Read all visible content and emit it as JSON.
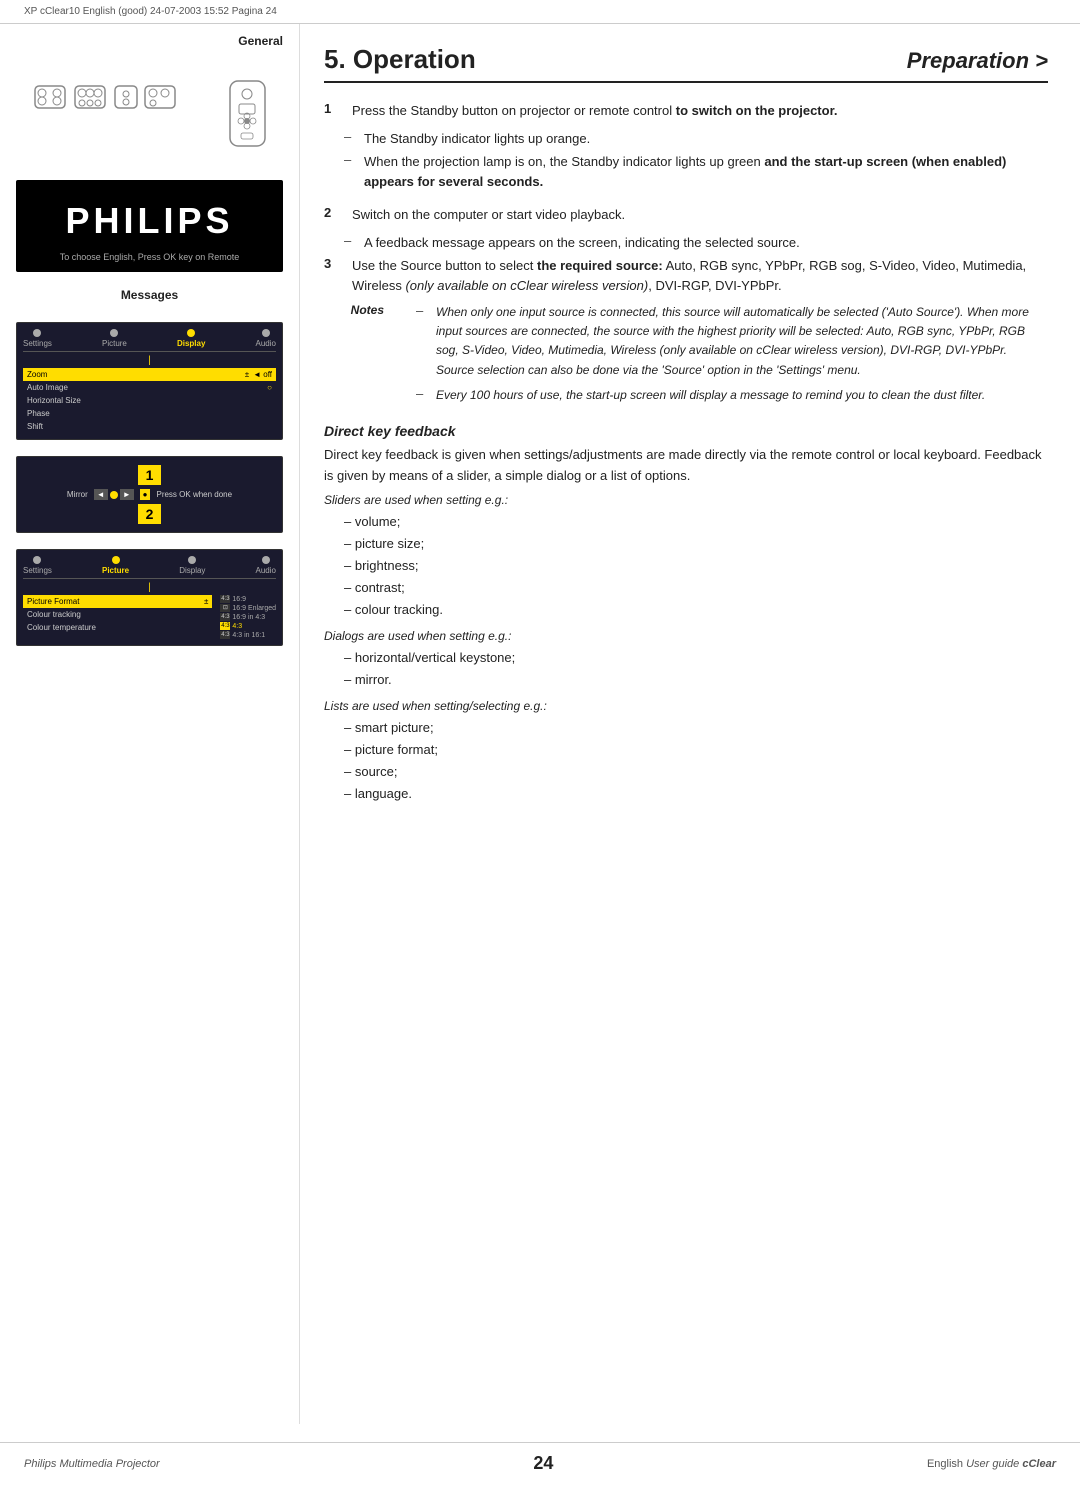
{
  "header": {
    "filename": "XP cClear10 English (good)  24-07-2003  15:52  Pagina 24"
  },
  "sidebar": {
    "general_label": "General",
    "messages_label": "Messages",
    "philips_logo": "PHILIPS",
    "philips_subtitle": "To choose English, Press OK key on Remote",
    "osd1": {
      "tabs": [
        "Settings",
        "Picture",
        "Display",
        "Audio"
      ],
      "active_tab": "Display",
      "rows": [
        {
          "label": "Zoom",
          "value": "±",
          "highlighted": true
        },
        {
          "label": "Auto Image",
          "value": "○"
        },
        {
          "label": "Horizontal Size",
          "value": ""
        },
        {
          "label": "Phase",
          "value": ""
        },
        {
          "label": "Shift",
          "value": ""
        }
      ]
    },
    "keystone": {
      "number_top": "1",
      "label": "Mirror",
      "arrows": [
        "◄",
        "•",
        "►"
      ],
      "press_label": "Press OK when done",
      "number_bottom": "2"
    },
    "osd2": {
      "tabs": [
        "Settings",
        "Picture",
        "Display",
        "Audio"
      ],
      "active_tab": "Picture",
      "rows": [
        {
          "label": "Picture Format",
          "highlighted": true
        },
        {
          "label": "Colour tracking"
        },
        {
          "label": "Colour temperature"
        }
      ],
      "options": [
        {
          "label": "4:3 16:9",
          "active": false
        },
        {
          "label": "16:9 Enlarged",
          "active": false
        },
        {
          "label": "4:3 16:9 in 4:3",
          "active": false
        },
        {
          "label": "4:3",
          "active": true
        },
        {
          "label": "4:3 4:3 in 16:1",
          "active": false
        }
      ]
    }
  },
  "main": {
    "title": "5. Operation",
    "subtitle": "Preparation >",
    "steps": [
      {
        "number": "1",
        "text": "Press the Standby button on projector or remote control to switch on the projector."
      },
      {
        "number": "2",
        "text": "Switch on the computer or start video playback."
      },
      {
        "number": "3",
        "text": "Use the Source button to select the required source: Auto, RGB sync, YPbPr, RGB sog, S-Video, Video, Mutimedia, Wireless (only available on cClear wireless version), DVI-RGP, DVI-YPbPr."
      }
    ],
    "dash_items_1": [
      "The Standby indicator lights up orange.",
      "When the projection lamp is on, the Standby indicator lights up green and the start-up screen (when enabled) appears for several seconds."
    ],
    "notes_label": "Notes",
    "notes_items": [
      "When only one input source is connected, this source will automatically be selected ('Auto Source'). When more input sources are connected, the source with the highest priority will be selected: Auto, RGB sync, YPbPr, RGB sog, S-Video, Video, Mutimedia, Wireless (only available on cClear wireless version), DVI-RGP, DVI-YPbPr. Source selection can also be done via the 'Source' option in the 'Settings' menu.",
      "Every 100 hours of use, the start-up screen will display a message to remind you to clean the dust filter."
    ],
    "direct_key_heading": "Direct key feedback",
    "direct_key_body": "Direct key feedback is given when settings/adjustments are made directly via the remote control or local keyboard. Feedback is given by means of a slider, a simple dialog or a list of options.",
    "sliders_label": "Sliders are used when setting e.g.:",
    "sliders_items": [
      "– volume;",
      "– picture size;",
      "– brightness;",
      "– contrast;",
      "– colour tracking."
    ],
    "dialogs_label": "Dialogs are used when setting e.g.:",
    "dialogs_items": [
      "– horizontal/vertical keystone;",
      "– mirror."
    ],
    "lists_label": "Lists are used when setting/selecting e.g.:",
    "lists_items": [
      "– smart picture;",
      "– picture format;",
      "– source;",
      "– language."
    ]
  },
  "footer": {
    "left": "Philips Multimedia Projector",
    "page_number": "24",
    "right_english": "English",
    "right_userguide": "User guide",
    "right_cclear": "cClear"
  }
}
